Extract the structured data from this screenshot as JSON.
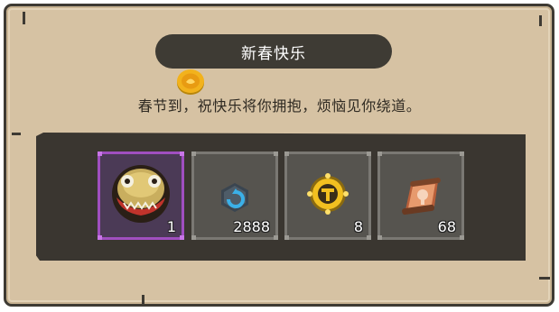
{
  "dialog": {
    "title": "新春快乐",
    "message": "春节到，祝快乐将你拥抱，烦恼见你绕道。"
  },
  "rewards": [
    {
      "icon": "golden-mask-icon",
      "count": "1",
      "rarity": "epic",
      "rarity_color": "#a04fc0"
    },
    {
      "icon": "blue-gem-icon",
      "count": "2888",
      "rarity": "common",
      "rarity_color": "#7a7873"
    },
    {
      "icon": "gold-medal-icon",
      "count": "8",
      "rarity": "common",
      "rarity_color": "#7a7873"
    },
    {
      "icon": "scroll-icon",
      "count": "68",
      "rarity": "common",
      "rarity_color": "#7a7873"
    }
  ]
}
